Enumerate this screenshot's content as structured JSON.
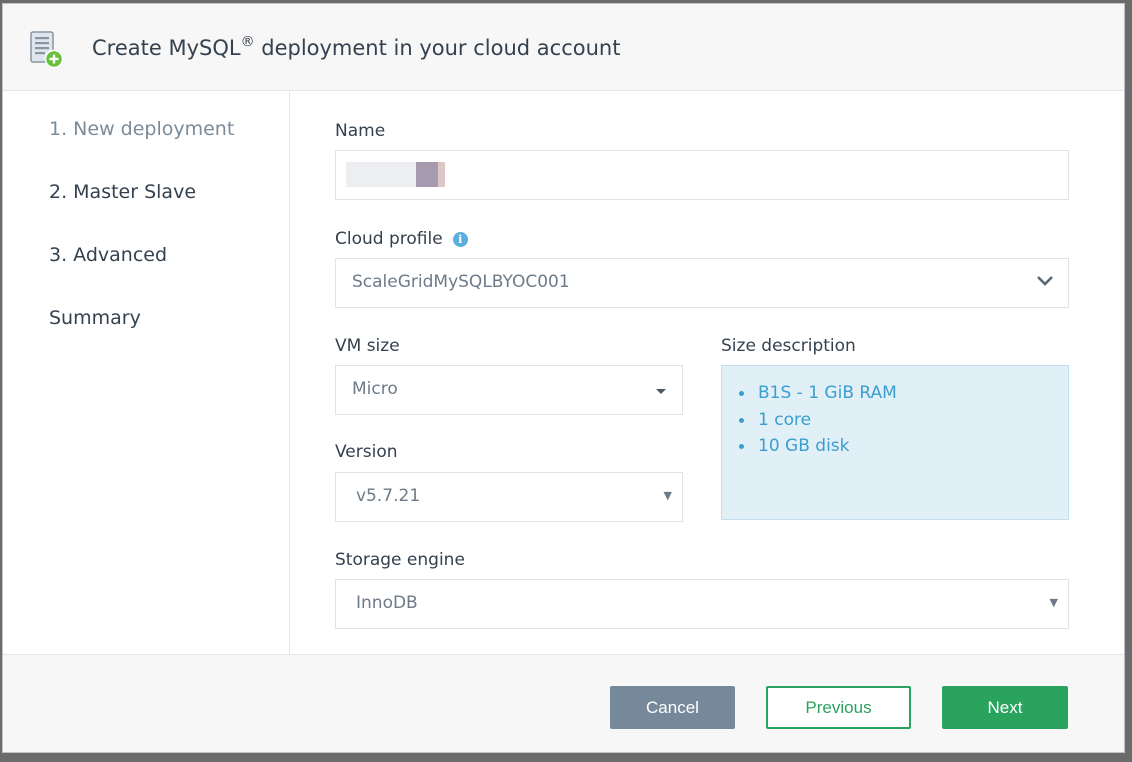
{
  "dialog": {
    "title": "Create MySQL",
    "title_reg": "®",
    "title_rest": " deployment in your cloud account"
  },
  "steps": [
    {
      "label": "1. New deployment",
      "active": true
    },
    {
      "label": "2. Master Slave",
      "active": false
    },
    {
      "label": "3. Advanced",
      "active": false
    },
    {
      "label": "Summary",
      "active": false
    }
  ],
  "form": {
    "name_label": "Name",
    "cloud_profile_label": "Cloud profile",
    "cloud_profile_value": "ScaleGridMySQLBYOC001",
    "vm_size_label": "VM size",
    "vm_size_value": "Micro",
    "version_label": "Version",
    "version_value": "v5.7.21",
    "storage_engine_label": "Storage engine",
    "storage_engine_value": "InnoDB",
    "size_description_label": "Size description",
    "size_description_items": [
      "B1S - 1 GiB RAM",
      "1 core",
      "10 GB disk"
    ]
  },
  "footer": {
    "cancel_label": "Cancel",
    "previous_label": "Previous",
    "next_label": "Next"
  },
  "colors": {
    "primary_green": "#2aa35e",
    "cancel_gray": "#76899a",
    "info_blue": "#3a9fd0"
  }
}
